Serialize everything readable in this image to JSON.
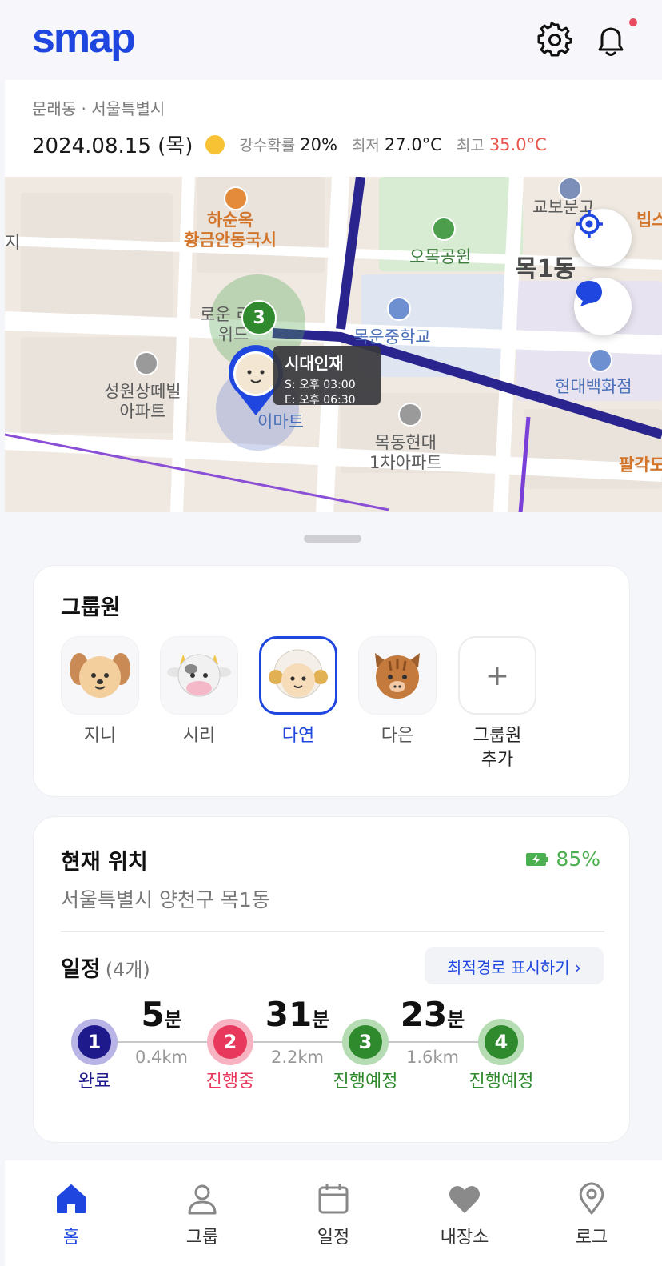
{
  "header": {
    "logo": "smap",
    "has_notification": true
  },
  "weather": {
    "location": "문래동 · 서울특별시",
    "date": "2024.08.15 (목)",
    "rain_label": "강수확률",
    "rain_value": "20%",
    "min_label": "최저",
    "min_value": "27.0°C",
    "max_label": "최고",
    "max_value": "35.0°C"
  },
  "map": {
    "labels": {
      "hasunok": "하순옥\n황금안동국시",
      "omok_park": "오목공원",
      "mok1": "목1동",
      "kyobo": "교보문고",
      "bip": "빕스",
      "rowun": "로운 리움\n위드",
      "omokjung": "목운중학교",
      "hyundai": "현대백화점",
      "seongwon": "성원상떼빌\n아파트",
      "emart": "이마트",
      "mokdong": "목동현대\n1차아파트",
      "palgakdo": "팔각도",
      "ji": "지"
    },
    "marker": {
      "name": "시대인재",
      "start": "S: 오후 03:00",
      "end": "E: 오후 06:30",
      "cluster_count": "3"
    }
  },
  "group": {
    "title": "그룹원",
    "members": [
      {
        "name": "지니",
        "avatar": "dog"
      },
      {
        "name": "시리",
        "avatar": "cow"
      },
      {
        "name": "다연",
        "avatar": "sheep",
        "selected": true
      },
      {
        "name": "다은",
        "avatar": "boar"
      }
    ],
    "add_label": "그룹원\n추가"
  },
  "location": {
    "title": "현재 위치",
    "battery": "85%",
    "address": "서울특별시 양천구 목1동"
  },
  "schedule": {
    "title": "일정",
    "count": "(4개)",
    "route_button": "최적경로 표시하기 ›",
    "stops": [
      {
        "num": "1",
        "status": "완료",
        "color": "#1f1a8c",
        "ring": "#b8b5e6"
      },
      {
        "num": "2",
        "status": "진행중",
        "color": "#e8385c",
        "ring": "#f7b3c1"
      },
      {
        "num": "3",
        "status": "진행예정",
        "color": "#2f8a2e",
        "ring": "#b5dcb2"
      },
      {
        "num": "4",
        "status": "진행예정",
        "color": "#2f8a2e",
        "ring": "#b5dcb2"
      }
    ],
    "segments": [
      {
        "minutes": "5",
        "unit": "분",
        "distance": "0.4km"
      },
      {
        "minutes": "31",
        "unit": "분",
        "distance": "2.2km"
      },
      {
        "minutes": "23",
        "unit": "분",
        "distance": "1.6km"
      }
    ]
  },
  "nav": {
    "items": [
      {
        "label": "홈",
        "icon": "home-icon",
        "active": true
      },
      {
        "label": "그룹",
        "icon": "person-icon"
      },
      {
        "label": "일정",
        "icon": "calendar-icon"
      },
      {
        "label": "내장소",
        "icon": "heart-icon"
      },
      {
        "label": "로그",
        "icon": "location-pin-icon"
      }
    ]
  },
  "colors": {
    "primary": "#1f47e0",
    "battery": "#4caf50",
    "hot": "#e8534a"
  }
}
